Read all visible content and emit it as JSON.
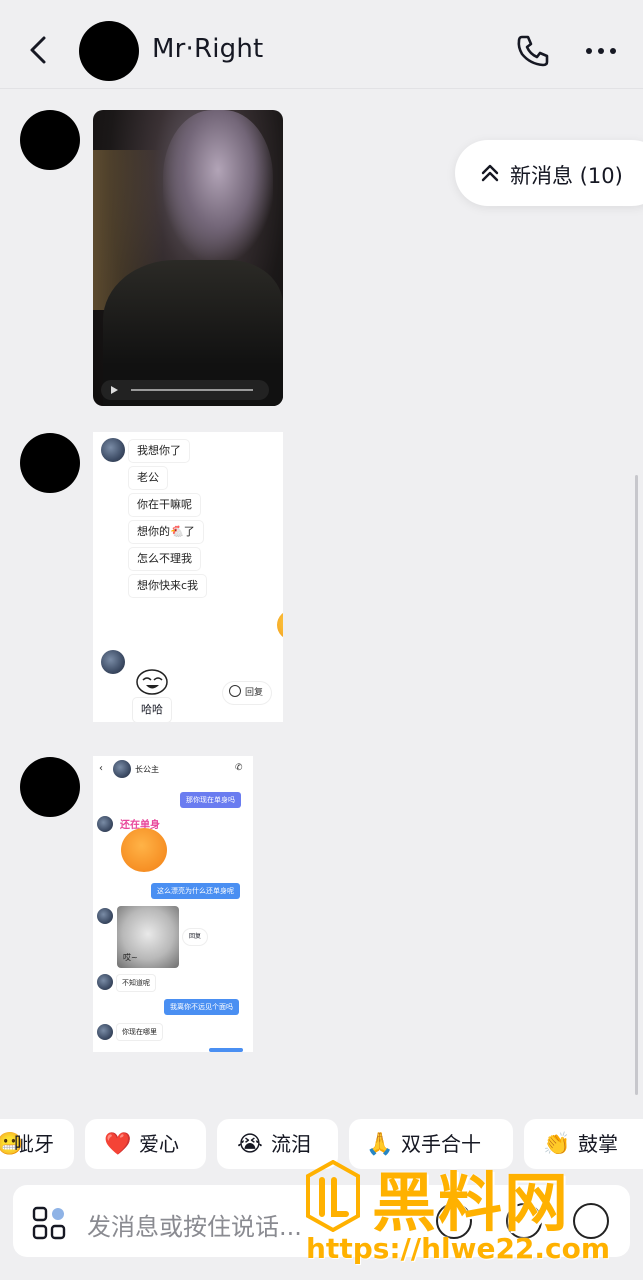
{
  "header": {
    "title": "Mr·Right",
    "back_icon": "chevron-left-icon",
    "call_icon": "phone-icon",
    "more_icon": "more-horizontal-icon"
  },
  "new_message_pill": {
    "label": "新消息 (10)",
    "icon": "double-chevron-up-icon"
  },
  "screenshot1": {
    "messages": [
      "我想你了",
      "老公",
      "你在干嘛呢",
      "想你的🐔了",
      "怎么不理我",
      "想你快来c我"
    ],
    "sticker_label": "哈哈",
    "reply_label": "回复"
  },
  "screenshot2": {
    "title": "长公主",
    "sticker_text": "还在单身",
    "messages": {
      "m1": "那你现在单身吗",
      "m2": "这么漂亮为什么还单身呢",
      "cat_label": "哎~",
      "reply_label": "回复",
      "m3": "不知道呢",
      "m4": "我离你不远见个面吗",
      "m5": "你现在哪里"
    }
  },
  "quick_reactions": [
    {
      "emoji": "😬",
      "label": "呲牙"
    },
    {
      "emoji": "❤️",
      "label": "爱心"
    },
    {
      "emoji": "😭",
      "label": "流泪"
    },
    {
      "emoji": "🙏",
      "label": "双手合十"
    },
    {
      "emoji": "👏",
      "label": "鼓掌"
    }
  ],
  "input": {
    "placeholder": "发消息或按住说话..."
  },
  "watermark": {
    "title": "黑料网",
    "url": "https://hlwe22.com"
  },
  "colors": {
    "background": "#efeff1",
    "accent_blue": "#4a8ff2",
    "watermark": "#ffb100"
  }
}
